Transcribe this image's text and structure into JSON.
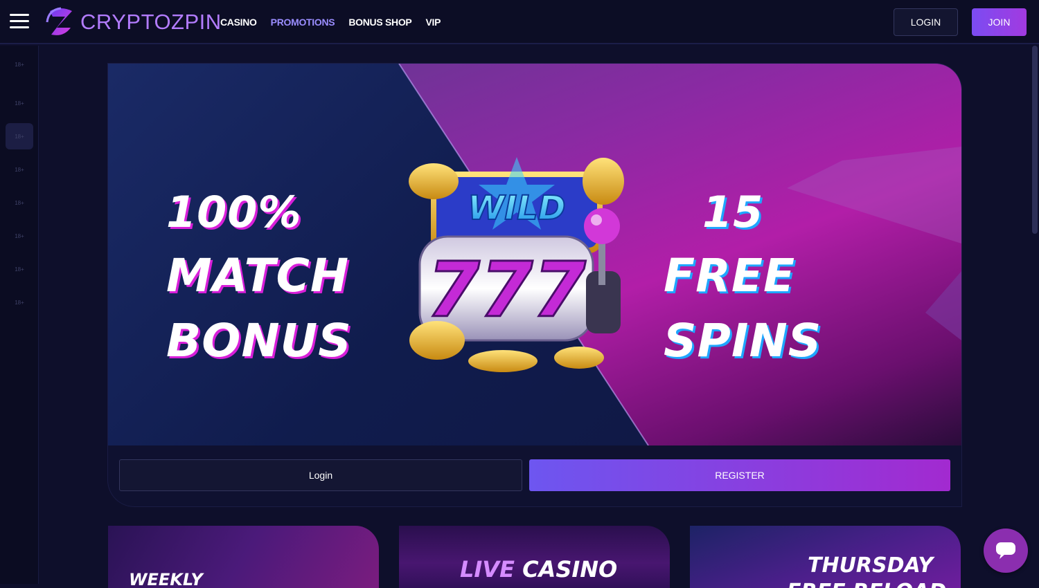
{
  "header": {
    "logo_text": "CRYPTOZPIN",
    "nav": [
      "CASINO",
      "PROMOTIONS",
      "BONUS SHOP",
      "VIP"
    ],
    "active_nav": "PROMOTIONS",
    "login_label": "LOGIN",
    "join_label": "JOIN"
  },
  "rail": {
    "items": [
      "18+",
      "18+",
      "18+",
      "18+",
      "18+",
      "18+",
      "18+",
      "18+"
    ]
  },
  "hero": {
    "left_line1": "100%",
    "left_line2": "MATCH",
    "left_line3": "BONUS",
    "right_line1": "15",
    "right_line2": "FREE",
    "right_line3": "SPINS",
    "slot_sign": "WILD",
    "slot_reels": "777",
    "login_label": "Login",
    "register_label": "REGISTER"
  },
  "promos": {
    "card1_title": "WEEKLY",
    "card2_title_a": "LIVE",
    "card2_title_b": "CASINO",
    "card3_title": "THURSDAY",
    "card3_sub": "FREE RELOAD"
  },
  "colors": {
    "accent": "#7b4cf2",
    "nav_active": "#9a8dff",
    "chat": "#8b2eaf"
  }
}
